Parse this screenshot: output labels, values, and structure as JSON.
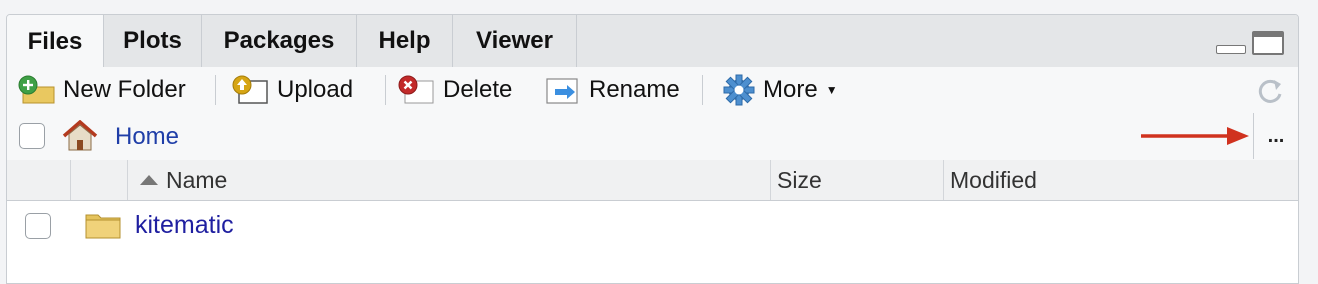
{
  "tabs": [
    {
      "label": "Files",
      "active": true
    },
    {
      "label": "Plots",
      "active": false
    },
    {
      "label": "Packages",
      "active": false
    },
    {
      "label": "Help",
      "active": false
    },
    {
      "label": "Viewer",
      "active": false
    }
  ],
  "toolbar": {
    "new_folder": "New Folder",
    "upload": "Upload",
    "delete": "Delete",
    "rename": "Rename",
    "more": "More"
  },
  "path": {
    "home": "Home",
    "more_dots": "..."
  },
  "table": {
    "columns": [
      "Name",
      "Size",
      "Modified"
    ],
    "rows": [
      {
        "name": "kitematic",
        "type": "folder",
        "size": "",
        "modified": ""
      }
    ]
  },
  "colors": {
    "link": "#1f3ea8",
    "annotation_arrow": "#d0321f",
    "panel_border": "#c9cdd2"
  }
}
